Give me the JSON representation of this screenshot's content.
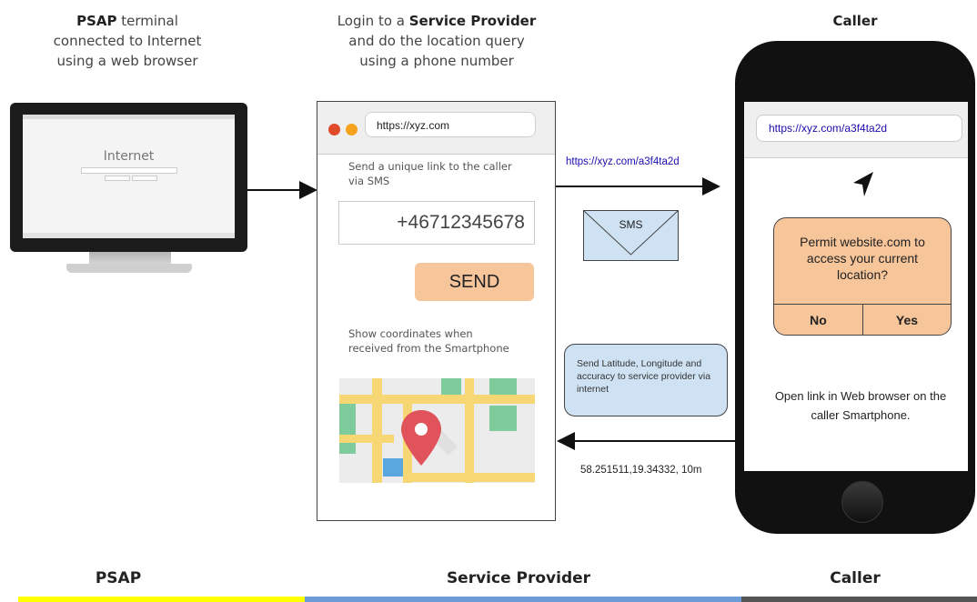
{
  "psap_caption": {
    "bold": "PSAP",
    "line1": " terminal",
    "line2": "connected to Internet",
    "line3": "using a web browser"
  },
  "provider_caption": {
    "line1a": "Login to a ",
    "line1b": "Service Provider",
    "line2": "and do the location query",
    "line3": "using a phone number"
  },
  "caller_caption": "Caller",
  "monitor": {
    "screen_title": "Internet"
  },
  "browser": {
    "url": "https://xyz.com",
    "dot_colors": [
      "#e04a2b",
      "#f5a31c"
    ],
    "send_link_text": "Send a unique link to the caller via SMS",
    "phone_number": "+46712345678",
    "send_button": "SEND",
    "show_coords_text": "Show coordinates when received from the Smartphone"
  },
  "sms_link": "https://xyz.com/a3f4ta2d",
  "sms_label": "SMS",
  "info_bubble": "Send Latitude, Longitude and accuracy to service provider via internet",
  "coordinates": "58.251511,19.34332, 10m",
  "smartphone": {
    "url": "https://xyz.com/a3f4ta2d",
    "dialog_text": "Permit website.com to access your current location?",
    "dialog_no": "No",
    "dialog_yes": "Yes",
    "instruction": "Open link in Web browser on the caller Smartphone."
  },
  "footer": [
    {
      "label": "PSAP",
      "color": "#ffff00"
    },
    {
      "label": "Service Provider",
      "color": "#6b9bd6"
    },
    {
      "label": "Caller",
      "color": "#555555"
    }
  ],
  "colors": {
    "orange": "#f7c59a",
    "bubble_blue": "#cfe2f3",
    "link_blue": "#1a0dab",
    "map_pin": "#e0535a"
  }
}
